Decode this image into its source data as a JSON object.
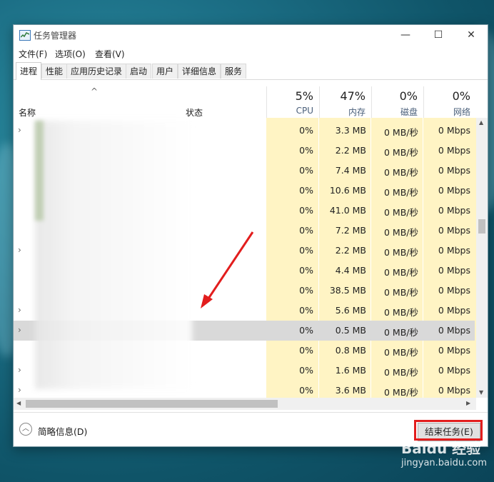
{
  "window": {
    "title": "任务管理器",
    "minimize": "—",
    "maximize": "☐",
    "close": "✕"
  },
  "menu": [
    "文件(F)",
    "选项(O)",
    "查看(V)"
  ],
  "tabs": [
    "进程",
    "性能",
    "应用历史记录",
    "启动",
    "用户",
    "详细信息",
    "服务"
  ],
  "columns": {
    "sort_arrow": "^",
    "name": "名称",
    "status": "状态",
    "cpu": {
      "pct": "5%",
      "label": "CPU"
    },
    "mem": {
      "pct": "47%",
      "label": "内存"
    },
    "disk": {
      "pct": "0%",
      "label": "磁盘"
    },
    "net": {
      "pct": "0%",
      "label": "网络"
    }
  },
  "rows": [
    {
      "expand": true,
      "cpu": "0%",
      "mem": "3.3 MB",
      "disk": "0 MB/秒",
      "net": "0 Mbps"
    },
    {
      "expand": false,
      "cpu": "0%",
      "mem": "2.2 MB",
      "disk": "0 MB/秒",
      "net": "0 Mbps"
    },
    {
      "expand": false,
      "cpu": "0%",
      "mem": "7.4 MB",
      "disk": "0 MB/秒",
      "net": "0 Mbps"
    },
    {
      "expand": false,
      "cpu": "0%",
      "mem": "10.6 MB",
      "disk": "0 MB/秒",
      "net": "0 Mbps"
    },
    {
      "expand": false,
      "cpu": "0%",
      "mem": "41.0 MB",
      "disk": "0 MB/秒",
      "net": "0 Mbps"
    },
    {
      "expand": false,
      "cpu": "0%",
      "mem": "7.2 MB",
      "disk": "0 MB/秒",
      "net": "0 Mbps"
    },
    {
      "expand": true,
      "cpu": "0%",
      "mem": "2.2 MB",
      "disk": "0 MB/秒",
      "net": "0 Mbps"
    },
    {
      "expand": false,
      "cpu": "0%",
      "mem": "4.4 MB",
      "disk": "0 MB/秒",
      "net": "0 Mbps"
    },
    {
      "expand": false,
      "cpu": "0%",
      "mem": "38.5 MB",
      "disk": "0 MB/秒",
      "net": "0 Mbps"
    },
    {
      "expand": true,
      "cpu": "0%",
      "mem": "5.6 MB",
      "disk": "0 MB/秒",
      "net": "0 Mbps"
    },
    {
      "expand": true,
      "cpu": "0%",
      "mem": "0.5 MB",
      "disk": "0 MB/秒",
      "net": "0 Mbps",
      "selected": true
    },
    {
      "expand": false,
      "cpu": "0%",
      "mem": "0.8 MB",
      "disk": "0 MB/秒",
      "net": "0 Mbps"
    },
    {
      "expand": true,
      "cpu": "0%",
      "mem": "1.6 MB",
      "disk": "0 MB/秒",
      "net": "0 Mbps"
    },
    {
      "expand": true,
      "cpu": "0%",
      "mem": "3.6 MB",
      "disk": "0 MB/秒",
      "net": "0 Mbps"
    }
  ],
  "footer": {
    "fewer_details": "简略信息(D)",
    "end_task": "结束任务(E)"
  },
  "watermark": {
    "brand": "Baidu 经验",
    "url": "jingyan.baidu.com"
  },
  "colors": {
    "highlight": "#e21d1d",
    "cpu_column": "#fff4c4",
    "selected_row": "#d9d9d9"
  }
}
